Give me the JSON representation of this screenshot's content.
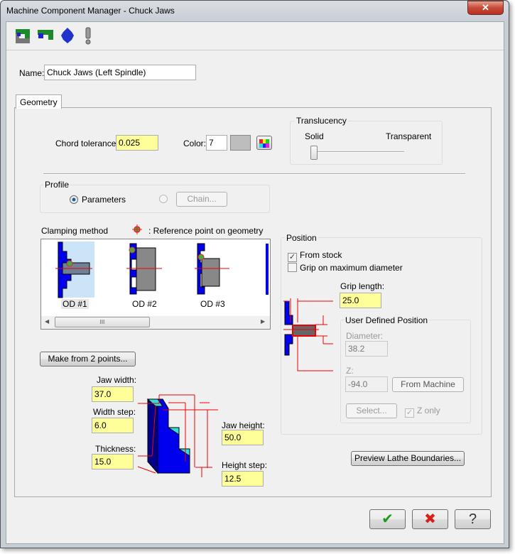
{
  "window": {
    "title": "Machine Component Manager - Chuck Jaws",
    "close": "✕"
  },
  "toolbar": {
    "icons": [
      "chuck-jaw-icon",
      "jaw-icon",
      "tailstock-icon",
      "warning-icon"
    ]
  },
  "name": {
    "label": "Name:",
    "value": "Chuck Jaws (Left Spindle)"
  },
  "tabs": [
    {
      "label": "Geometry"
    }
  ],
  "geometry": {
    "chord_tolerance": {
      "label": "Chord tolerance:",
      "value": "0.025"
    },
    "color": {
      "label": "Color:",
      "value": "7",
      "swatch": "#c0c0c0"
    },
    "translucency": {
      "label": "Translucency",
      "min_label": "Solid",
      "max_label": "Transparent",
      "value": 0
    },
    "profile": {
      "label": "Profile",
      "parameters": "Parameters",
      "chain": "Chain...",
      "selected": "Parameters"
    },
    "clamping": {
      "label": "Clamping method",
      "ref_note": ": Reference point on geometry",
      "items": [
        "OD #1",
        "OD #2",
        "OD #3"
      ],
      "selected": "OD #1",
      "scroll_grip": "III"
    },
    "make_button": "Make from 2 points...",
    "jaw_width": {
      "label": "Jaw width:",
      "value": "37.0"
    },
    "width_step": {
      "label": "Width step:",
      "value": "6.0"
    },
    "thickness": {
      "label": "Thickness:",
      "value": "15.0"
    },
    "jaw_height": {
      "label": "Jaw height:",
      "value": "50.0"
    },
    "height_step": {
      "label": "Height step:",
      "value": "12.5"
    },
    "position": {
      "label": "Position",
      "from_stock": "From stock",
      "from_stock_checked": true,
      "grip_max": "Grip on maximum diameter",
      "grip_max_checked": false,
      "grip_length": {
        "label": "Grip length:",
        "value": "25.0"
      },
      "user_defined": {
        "label": "User Defined Position",
        "diameter_label": "Diameter:",
        "diameter": "38.2",
        "z_label": "Z:",
        "z": "-94.0",
        "from_machine": "From Machine",
        "select": "Select...",
        "z_only": "Z only",
        "z_only_checked": true
      }
    },
    "preview_button": "Preview Lathe Boundaries..."
  },
  "footer": {
    "ok": "✔",
    "cancel": "✖",
    "help": "?"
  }
}
